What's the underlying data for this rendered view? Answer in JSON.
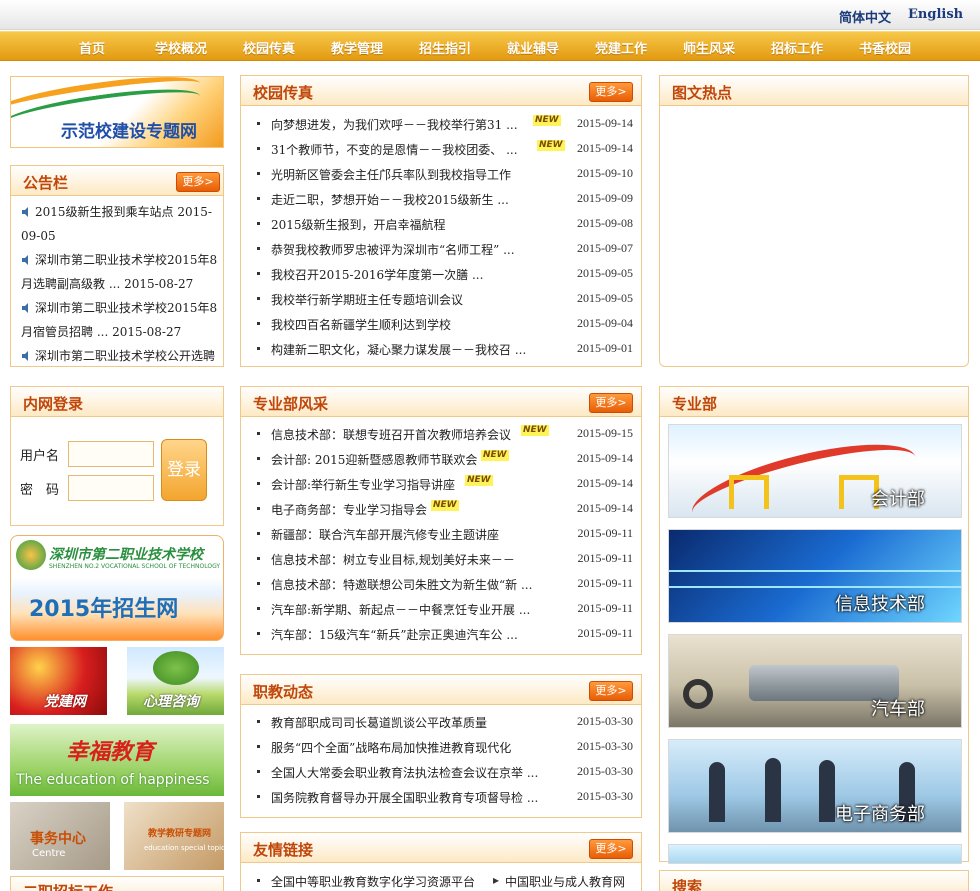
{
  "header": {
    "lang_cn": "简体中文",
    "lang_en": "English"
  },
  "nav": [
    "首页",
    "学校概况",
    "校园传真",
    "教学管理",
    "招生指引",
    "就业辅导",
    "党建工作",
    "师生风采",
    "招标工作",
    "书香校园"
  ],
  "left": {
    "demo_banner": "示范校建设专题网",
    "notice": {
      "title": "公告栏",
      "more": "更多>",
      "items": [
        "2015级新生报到乘车站点  2015-09-05",
        "深圳市第二职业技术学校2015年8月选聘副高级教  ... 2015-08-27",
        "深圳市第二职业技术学校2015年8月宿管员招聘  ... 2015-08-27",
        "深圳市第二职业技术学校公开选聘"
      ]
    },
    "login": {
      "title": "内网登录",
      "user_label": "用户名",
      "pass_label": "密　码",
      "button": "登录"
    },
    "recruit_banner": {
      "school_cn": "深圳市第二职业技术学校",
      "school_en": "SHENZHEN NO.2 VOCATIONAL SCHOOL OF TECHNOLOGY",
      "title": "2015年招生网"
    },
    "party": "党建网",
    "psych": "心理咨询",
    "happy": {
      "cn": "幸福教育",
      "en": "The education of happiness"
    },
    "affairs": {
      "cn": "事务中心",
      "en": "Centre"
    },
    "topic": {
      "cn": "教学教研专题网",
      "en": "education special topic"
    },
    "bottom_title": "二职招标工作"
  },
  "campus": {
    "title": "校园传真",
    "more": "更多>",
    "items": [
      {
        "text": "向梦想进发，为我们欢呼－－我校举行第31 ...",
        "new": "NEW",
        "date": "2015-09-14"
      },
      {
        "text": "31个教师节，不变的是恩情－－我校团委、 ...",
        "new": "NEW",
        "date": "2015-09-14"
      },
      {
        "text": "光明新区管委会主任邝兵率队到我校指导工作",
        "new": "",
        "date": "2015-09-10"
      },
      {
        "text": "走近二职，梦想开始－－我校2015级新生  ...",
        "new": "",
        "date": "2015-09-09"
      },
      {
        "text": "2015级新生报到，开启幸福航程",
        "new": "",
        "date": "2015-09-08"
      },
      {
        "text": "恭贺我校教师罗忠被评为深圳市“名师工程” ...",
        "new": "",
        "date": "2015-09-07"
      },
      {
        "text": "我校召开2015-2016学年度第一次膳  ...",
        "new": "",
        "date": "2015-09-05"
      },
      {
        "text": "我校举行新学期班主任专题培训会议",
        "new": "",
        "date": "2015-09-05"
      },
      {
        "text": "我校四百名新疆学生顺利达到学校",
        "new": "",
        "date": "2015-09-04"
      },
      {
        "text": "构建新二职文化，凝心聚力谋发展－－我校召  ...",
        "new": "",
        "date": "2015-09-01"
      }
    ]
  },
  "dept_news": {
    "title": "专业部风采",
    "more": "更多>",
    "items": [
      {
        "text": "信息技术部：联想专班召开首次教师培养会议",
        "new": "NEW",
        "date": "2015-09-15"
      },
      {
        "text": "会计部: 2015迎新暨感恩教师节联欢会",
        "new": "NEW",
        "date": "2015-09-14"
      },
      {
        "text": "会计部:举行新生专业学习指导讲座",
        "new": "NEW",
        "date": "2015-09-14"
      },
      {
        "text": "电子商务部：专业学习指导会",
        "new": "NEW",
        "date": "2015-09-14"
      },
      {
        "text": "新疆部：联合汽车部开展汽修专业主题讲座",
        "new": "",
        "date": "2015-09-11"
      },
      {
        "text": "信息技术部：树立专业目标,规划美好未来－－ ",
        "new": "",
        "date": "2015-09-11"
      },
      {
        "text": "信息技术部：特邀联想公司朱胜文为新生做“新  ...",
        "new": "",
        "date": "2015-09-11"
      },
      {
        "text": "汽车部:新学期、新起点－－中餐烹饪专业开展  ...",
        "new": "",
        "date": "2015-09-11"
      },
      {
        "text": "汽车部：15级汽车“新兵”赴宗正奥迪汽车公  ...",
        "new": "",
        "date": "2015-09-11"
      }
    ]
  },
  "voc_news": {
    "title": "职教动态",
    "more": "更多>",
    "items": [
      {
        "text": "教育部职成司司长葛道凯谈公平改革质量",
        "new": "",
        "date": "2015-03-30"
      },
      {
        "text": "服务“四个全面”战略布局加快推进教育现代化",
        "new": "",
        "date": "2015-03-30"
      },
      {
        "text": "全国人大常委会职业教育法执法检查会议在京举  ...",
        "new": "",
        "date": "2015-03-30"
      },
      {
        "text": "国务院教育督导办开展全国职业教育专项督导检  ...",
        "new": "",
        "date": "2015-03-30"
      }
    ]
  },
  "links": {
    "title": "友情链接",
    "more": "更多>",
    "items": [
      "全国中等职业教育数字化学习资源平台",
      "中国职业与成人教育网"
    ]
  },
  "right": {
    "hot_title": "图文热点",
    "dept_title": "专业部",
    "depts": [
      "会计部",
      "信息技术部",
      "汽车部",
      "电子商务部"
    ],
    "search_title": "搜索"
  },
  "colors": {
    "accent": "#c0470b",
    "nav": "#e39a10",
    "border": "#f0c98a"
  }
}
